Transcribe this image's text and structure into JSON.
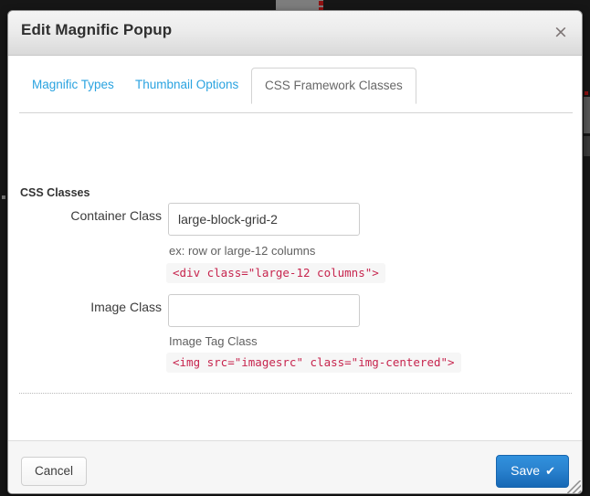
{
  "modal": {
    "title": "Edit Magnific Popup",
    "close_icon": "close-icon",
    "close_glyph": "×"
  },
  "tabs": [
    {
      "label": "Magnific Types",
      "active": false
    },
    {
      "label": "Thumbnail Options",
      "active": false
    },
    {
      "label": "CSS Framework Classes",
      "active": true
    }
  ],
  "form": {
    "section_label": "CSS Classes",
    "fields": [
      {
        "label": "Container Class",
        "value": "large-block-grid-2",
        "placeholder": "",
        "help": "ex: row or large-12 columns",
        "code": "<div class=\"large-12 columns\">"
      },
      {
        "label": "Image Class",
        "value": "",
        "placeholder": "",
        "help": "Image Tag Class",
        "code": "<img src=\"imagesrc\" class=\"img-centered\">"
      }
    ]
  },
  "footer": {
    "cancel_label": "Cancel",
    "save_label": "Save",
    "save_check_glyph": "✔",
    "resize_grip_icon": "resize-grip-icon"
  },
  "colors": {
    "tab_link": "#2aa3e0",
    "save_button": "#2a82cf",
    "code_text": "#c7254e",
    "header_gradient_top": "#f4f4f4",
    "header_gradient_bottom": "#d9d9d9",
    "backdrop": "#161616"
  }
}
